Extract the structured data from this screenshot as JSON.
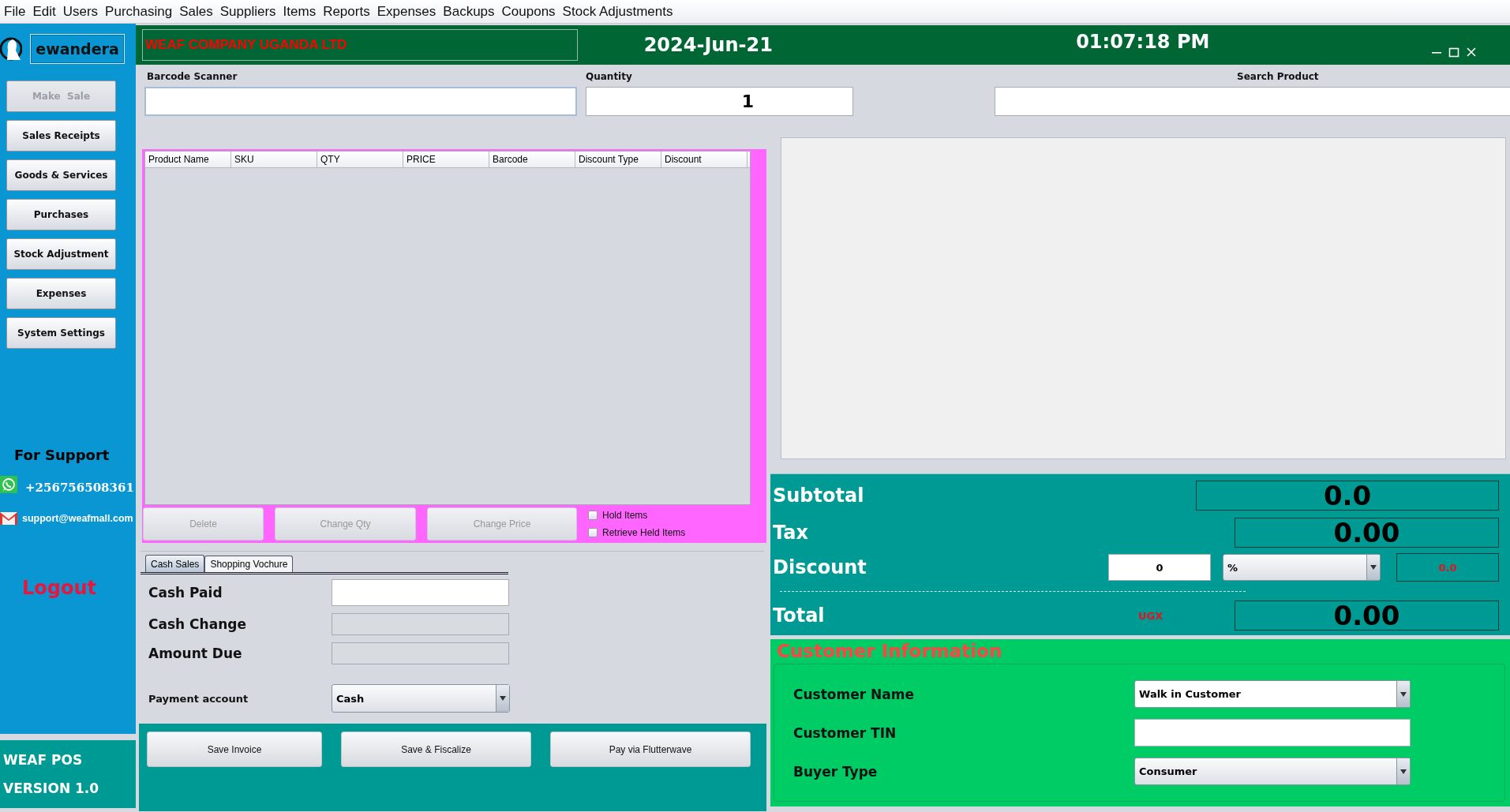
{
  "menu": [
    "File",
    "Edit",
    "Users",
    "Purchasing",
    "Sales",
    "Suppliers",
    "Items",
    "Reports",
    "Expenses",
    "Backups",
    "Coupons",
    "Stock Adjustments"
  ],
  "user": {
    "name": "ewandera"
  },
  "nav": [
    {
      "label": "Make  Sale",
      "disabled": true
    },
    {
      "label": "Sales Receipts",
      "disabled": false
    },
    {
      "label": "Goods & Services",
      "disabled": false
    },
    {
      "label": "Purchases",
      "disabled": false
    },
    {
      "label": "Stock Adjustment",
      "disabled": false
    },
    {
      "label": "Expenses",
      "disabled": false
    },
    {
      "label": "System Settings",
      "disabled": false
    }
  ],
  "support": {
    "title": "For Support",
    "phone": "+256756508361",
    "email": "support@weafmall.com"
  },
  "logout": "Logout",
  "app": {
    "name": "WEAF POS",
    "version": "VERSION 1.0"
  },
  "header": {
    "company": "WEAF COMPANY UGANDA LTD",
    "date": "2024-Jun-21",
    "time": "01:07:18 PM"
  },
  "scan": {
    "barcode_label": "Barcode Scanner",
    "quantity_label": "Quantity",
    "quantity": "1",
    "search_label": "Search Product"
  },
  "cart": {
    "columns": [
      "Product Name",
      "SKU",
      "QTY",
      "PRICE",
      "Barcode",
      "Discount Type",
      "Discount"
    ],
    "actions": [
      {
        "label": "Delete",
        "disabled": true
      },
      {
        "label": "Change Qty",
        "disabled": true
      },
      {
        "label": "Change Price",
        "disabled": true
      }
    ],
    "options": [
      {
        "label": "Hold Items",
        "checked": false
      },
      {
        "label": "Retrieve Held Items",
        "checked": false
      }
    ]
  },
  "payment": {
    "tabs": [
      {
        "label": "Cash Sales",
        "selected": true
      },
      {
        "label": "Shopping Vochure",
        "selected": false
      }
    ],
    "fields": [
      {
        "label": "Cash Paid",
        "kind": "input",
        "disabled": false
      },
      {
        "label": "Cash Change",
        "kind": "input",
        "disabled": true
      },
      {
        "label": "Amount Due",
        "kind": "input",
        "disabled": true
      },
      {
        "label": "Payment account",
        "kind": "select",
        "value": "Cash"
      }
    ],
    "buttons": [
      "Save Invoice",
      "Save & Fiscalize",
      "Pay via Flutterwave"
    ]
  },
  "totals": {
    "subtotal_label": "Subtotal",
    "subtotal": "0.0",
    "tax_label": "Tax",
    "tax": "0.00",
    "discount_label": "Discount",
    "discount_input": "0",
    "discount_type": "%",
    "discount_amount": "0.0",
    "total_label": "Total",
    "currency": "UGX",
    "total": "0.00"
  },
  "customer": {
    "title": "Customer Information",
    "fields": [
      {
        "label": "Customer Name",
        "kind": "select",
        "value": "Walk in Customer"
      },
      {
        "label": "Customer TIN",
        "kind": "input"
      },
      {
        "label": "Buyer Type",
        "kind": "select",
        "value": "Consumer"
      }
    ]
  }
}
